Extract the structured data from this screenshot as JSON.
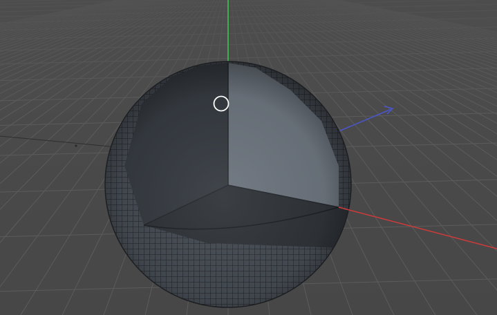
{
  "viewport": {
    "background_color": "#4b4b4b",
    "grid_line_color": "#5c5c5c",
    "axis_colors": {
      "x": "#d23a3a",
      "y": "#3fae4a",
      "z": "#4a55c9"
    },
    "object": {
      "type": "sphere",
      "cutaway": "octant",
      "outer_mesh_color": "#444a52",
      "wireframe_color": "#1e2124",
      "cut_face_light_color": "#6b737c",
      "cut_face_dark_color": "#353a40",
      "cut_face_bottom_color": "#2f3338"
    },
    "cursor": {
      "icon": "circle-cursor-icon",
      "color": "#ffffff"
    }
  }
}
